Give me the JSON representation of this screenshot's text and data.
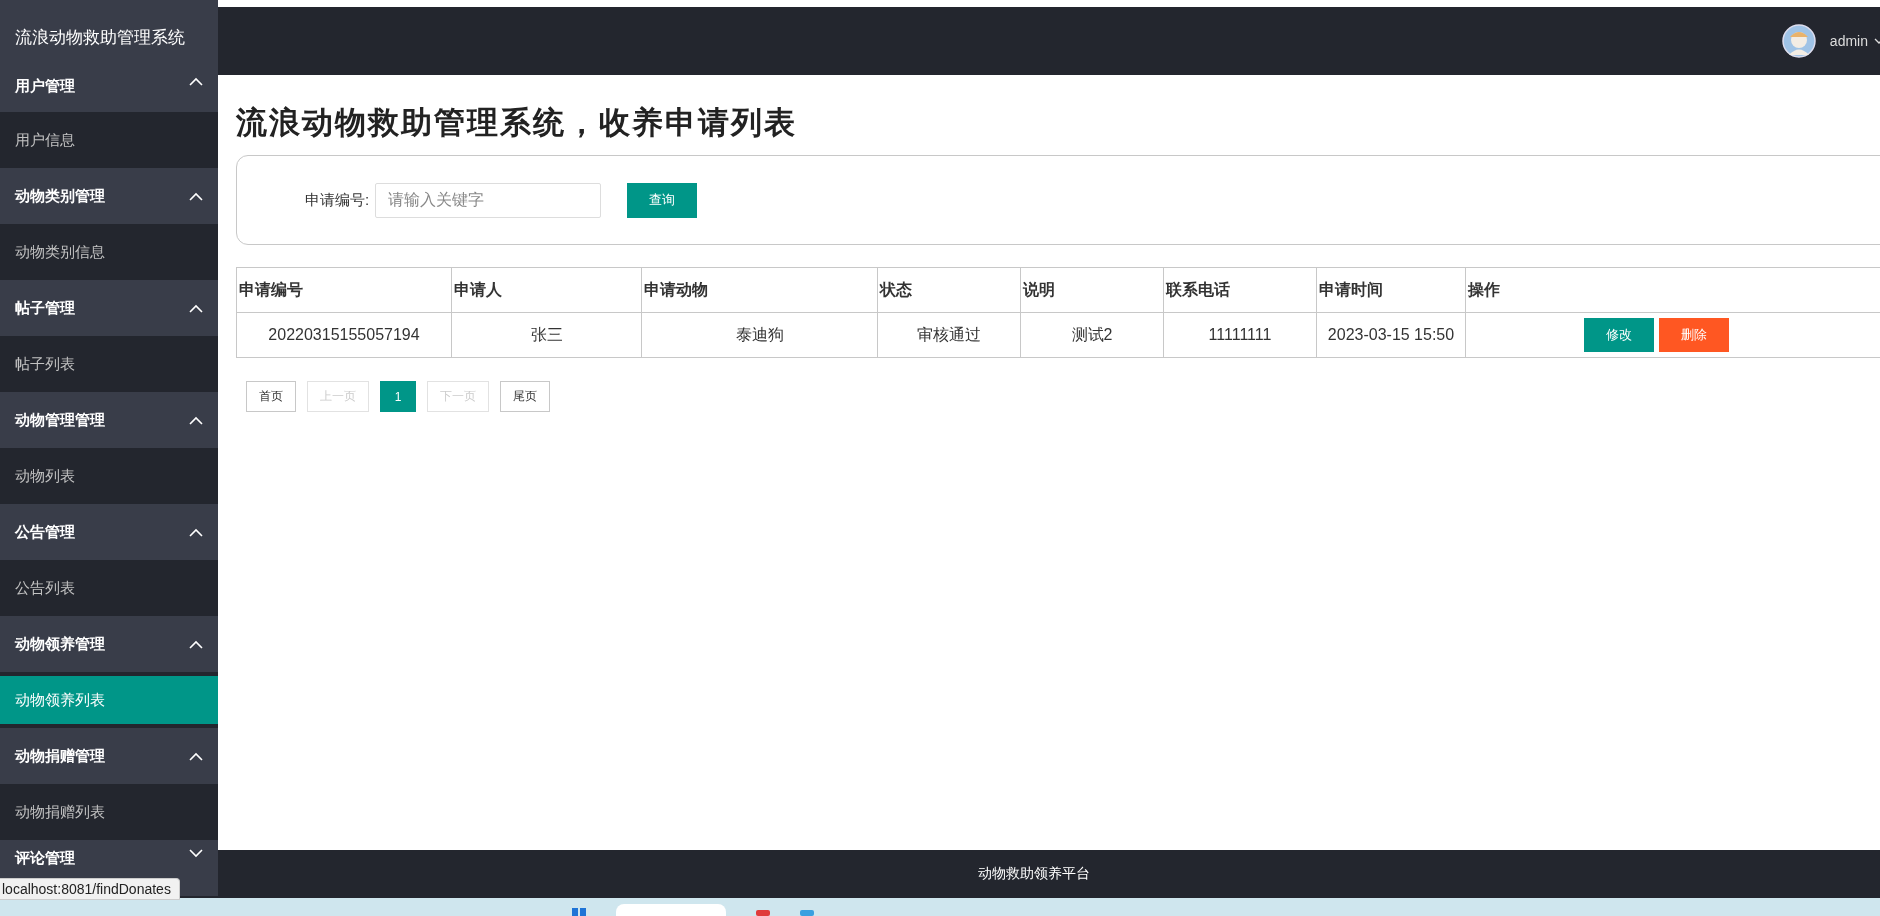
{
  "app_title": "流浪动物救助管理系统",
  "header": {
    "user": "admin"
  },
  "sidebar": {
    "groups": [
      {
        "label": "用户管理",
        "expanded": true,
        "items": [
          {
            "label": "用户信息",
            "selected": false
          }
        ]
      },
      {
        "label": "动物类别管理",
        "expanded": true,
        "items": [
          {
            "label": "动物类别信息",
            "selected": false
          }
        ]
      },
      {
        "label": "帖子管理",
        "expanded": true,
        "items": [
          {
            "label": "帖子列表",
            "selected": false
          }
        ]
      },
      {
        "label": "动物管理管理",
        "expanded": true,
        "items": [
          {
            "label": "动物列表",
            "selected": false
          }
        ]
      },
      {
        "label": "公告管理",
        "expanded": true,
        "items": [
          {
            "label": "公告列表",
            "selected": false
          }
        ]
      },
      {
        "label": "动物领养管理",
        "expanded": true,
        "items": [
          {
            "label": "动物领养列表",
            "selected": true
          }
        ]
      },
      {
        "label": "动物捐赠管理",
        "expanded": true,
        "items": [
          {
            "label": "动物捐赠列表",
            "selected": false
          }
        ]
      },
      {
        "label": "评论管理",
        "expanded": false
      }
    ]
  },
  "page_title": "流浪动物救助管理系统，收养申请列表",
  "search": {
    "label": "申请编号:",
    "placeholder": "请输入关键字",
    "button": "查询"
  },
  "table": {
    "columns": [
      "申请编号",
      "申请人",
      "申请动物",
      "状态",
      "说明",
      "联系电话",
      "申请时间",
      "操作"
    ],
    "rows": [
      {
        "cells": [
          "20220315155057194",
          "张三",
          "泰迪狗",
          "审核通过",
          "测试2",
          "11111111",
          "2023-03-15 15:50"
        ],
        "actions": [
          "修改",
          "删除"
        ]
      }
    ]
  },
  "pagination": [
    {
      "label": "首页",
      "disabled": false,
      "selected": false
    },
    {
      "label": "上一页",
      "disabled": true,
      "selected": false
    },
    {
      "label": "1",
      "disabled": false,
      "selected": true
    },
    {
      "label": "下一页",
      "disabled": true,
      "selected": false
    },
    {
      "label": "尾页",
      "disabled": false,
      "selected": false
    }
  ],
  "footer": "动物救助领养平台",
  "status_tooltip": "localhost:8081/findDonates"
}
